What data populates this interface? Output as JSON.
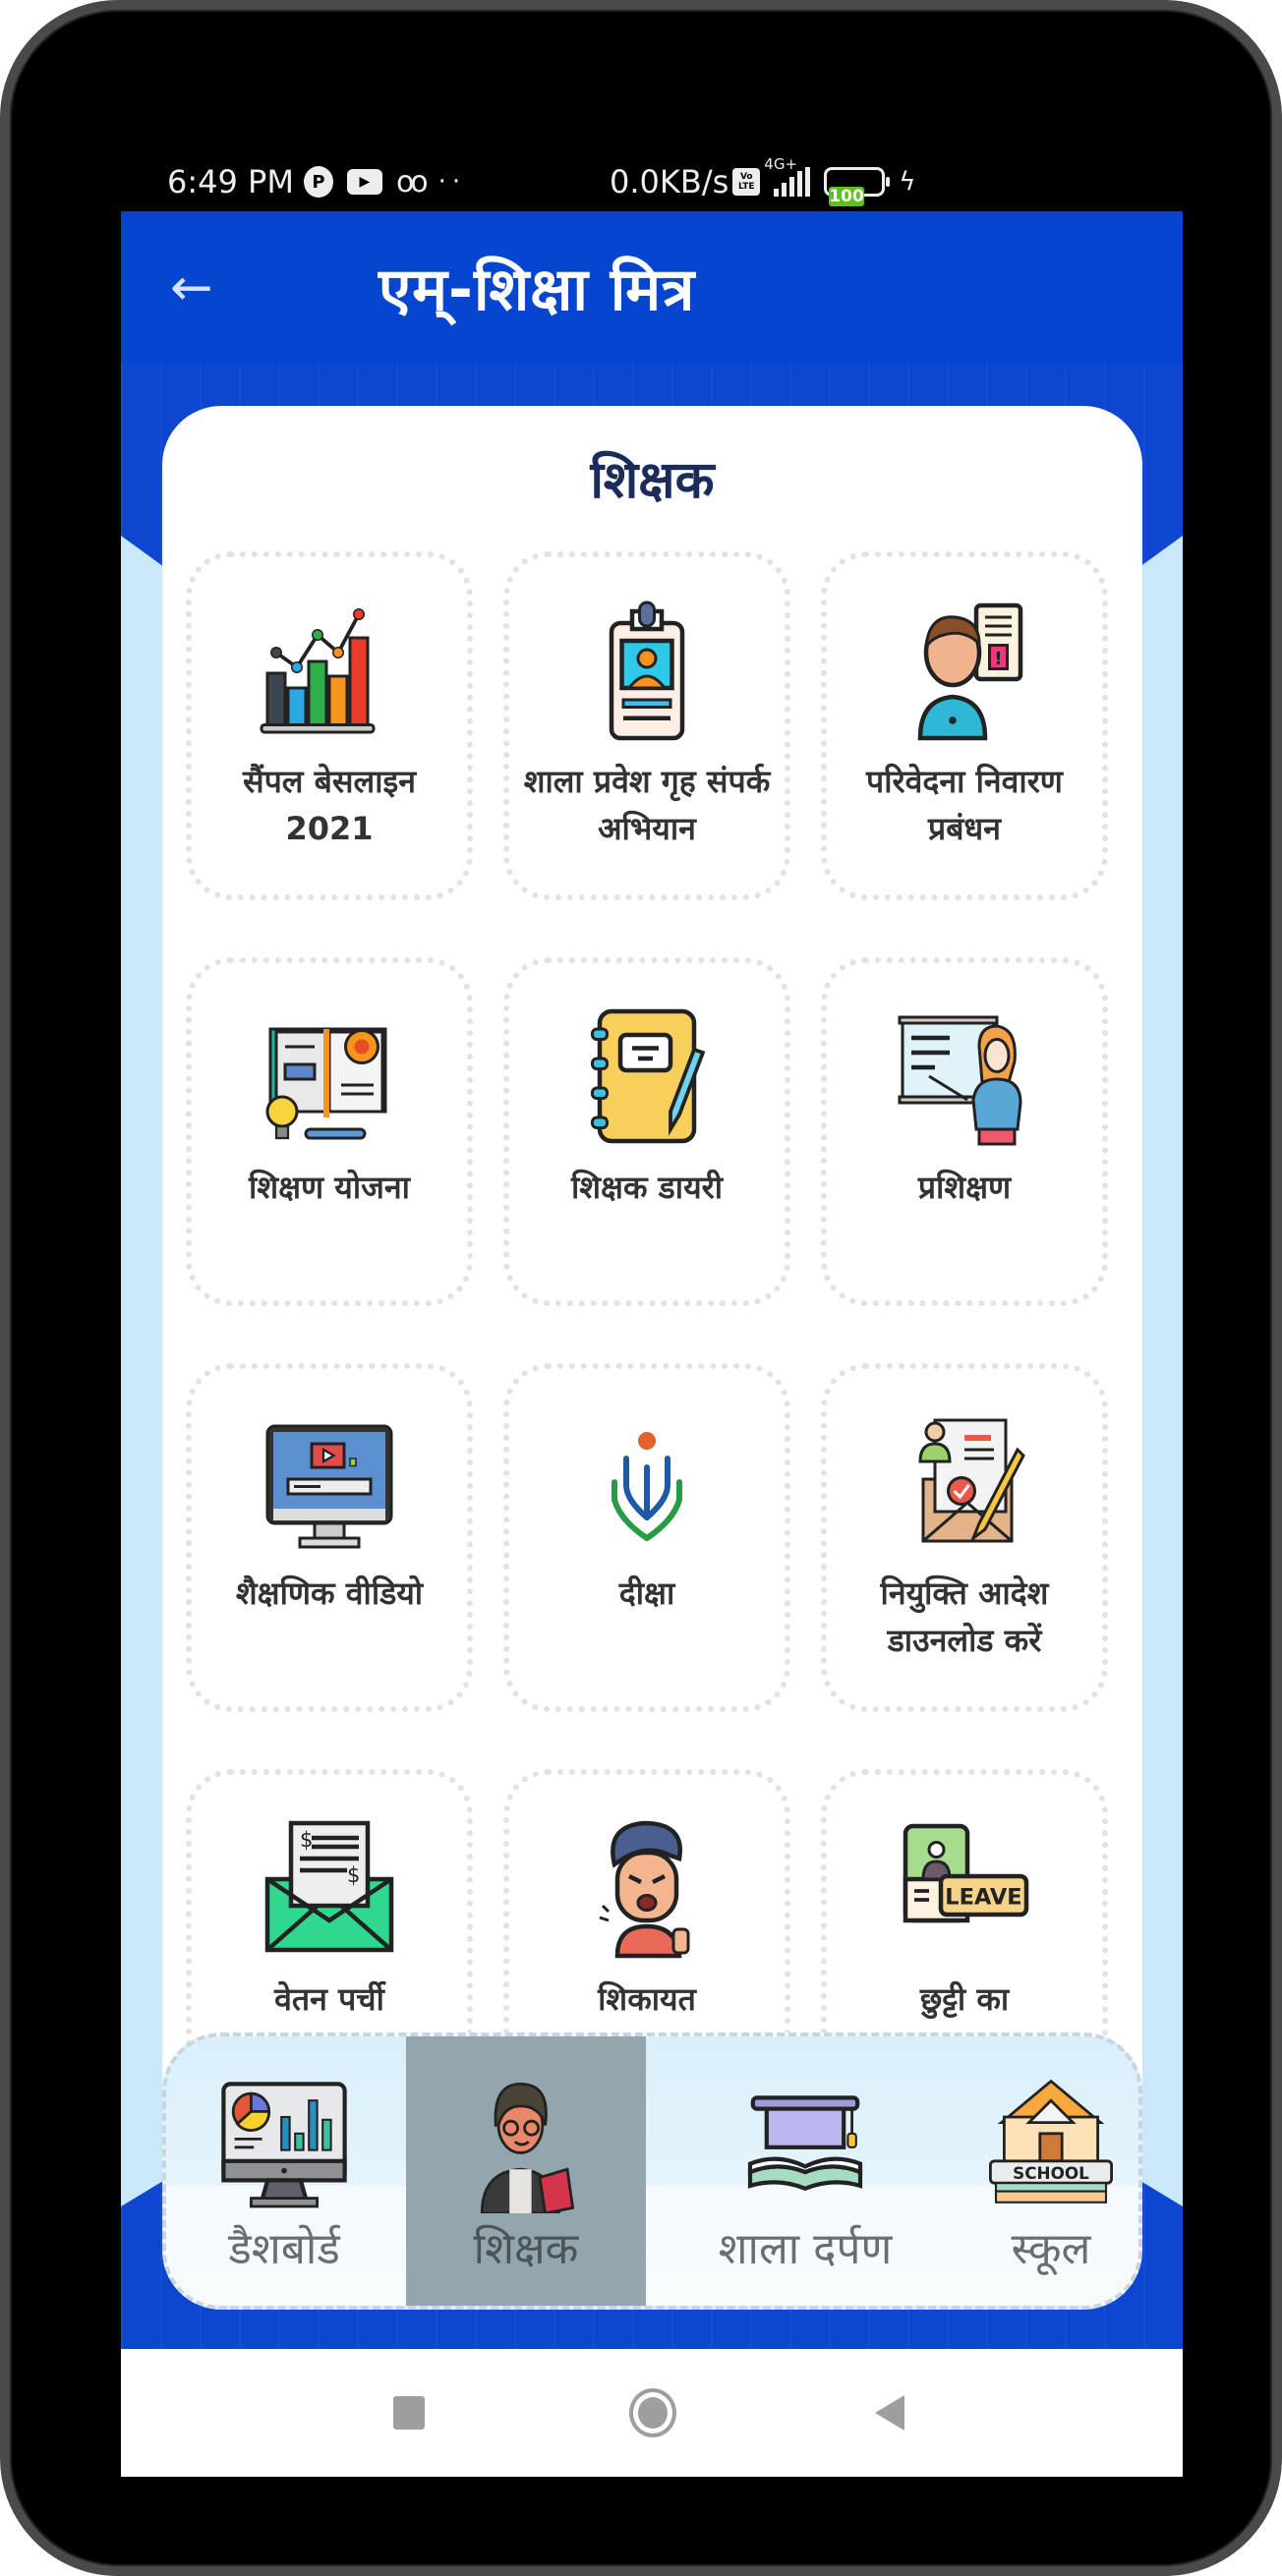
{
  "status_bar": {
    "time": "6:49 PM",
    "network_speed": "0.0KB/s",
    "volte": [
      "Vo",
      "LTE"
    ],
    "network_type": "4G+",
    "battery_level": "100",
    "charging": true
  },
  "app_bar": {
    "back_icon": "arrow-left-icon",
    "title": "एम्-शिक्षा मित्र"
  },
  "section": {
    "title": "शिक्षक",
    "tiles": [
      {
        "label": "सैंपल बेसलाइन 2021",
        "icon": "bar-chart-icon"
      },
      {
        "label": "शाला प्रवेश गृह संपर्क अभियान",
        "icon": "id-badge-icon"
      },
      {
        "label": "परिवेदना निवारण प्रबंधन",
        "icon": "grievance-person-icon"
      },
      {
        "label": "शिक्षण योजना",
        "icon": "lesson-plan-icon"
      },
      {
        "label": "शिक्षक डायरी",
        "icon": "diary-icon"
      },
      {
        "label": "प्रशिक्षण",
        "icon": "training-board-icon"
      },
      {
        "label": "शैक्षणिक वीडियो",
        "icon": "video-monitor-icon"
      },
      {
        "label": "दीक्षा",
        "icon": "diksha-logo-icon"
      },
      {
        "label": "नियुक्ति आदेश डाउनलोड करें",
        "icon": "appointment-letter-icon"
      },
      {
        "label": "वेतन पर्ची",
        "icon": "salary-slip-icon"
      },
      {
        "label": "शिकायत",
        "icon": "complaint-person-icon"
      },
      {
        "label": "छुट्टी का",
        "icon": "leave-icon"
      }
    ]
  },
  "bottom_nav": {
    "items": [
      {
        "label": "डैशबोर्ड",
        "icon": "dashboard-monitor-icon",
        "active": false
      },
      {
        "label": "शिक्षक",
        "icon": "teacher-icon",
        "active": true
      },
      {
        "label": "शाला दर्पण",
        "icon": "graduation-book-icon",
        "active": false
      },
      {
        "label": "स्कूल",
        "icon": "school-building-icon",
        "active": false
      }
    ]
  },
  "system_nav": {
    "recent": "recent-apps-icon",
    "home": "home-icon",
    "back": "back-triangle-icon"
  },
  "colors": {
    "app_bar": "#0645cf",
    "card_title": "#1b2b5c",
    "active_nav": "#93a6ad",
    "light_band": "#c9e9fb"
  }
}
